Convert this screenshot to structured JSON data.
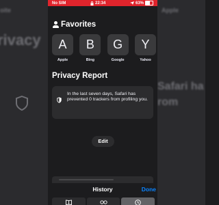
{
  "status_bar": {
    "carrier": "No SIM",
    "time": "22:34",
    "battery": "63%"
  },
  "background": {
    "left_text": "rivacy",
    "left_sub": "oite",
    "right_text": [
      "Safari ha",
      "rom"
    ],
    "right_top": "Apple"
  },
  "favorites": {
    "title": "Favorites",
    "items": [
      {
        "letter": "A",
        "label": "Apple"
      },
      {
        "letter": "B",
        "label": "Bing"
      },
      {
        "letter": "G",
        "label": "Google"
      },
      {
        "letter": "Y",
        "label": "Yahoo"
      }
    ]
  },
  "privacy_report": {
    "title": "Privacy Report",
    "text": "In the last seven days, Safari has prevented 0 trackers from profiling you."
  },
  "edit_label": "Edit",
  "sheet": {
    "title": "History",
    "done_label": "Done",
    "tab_icons": [
      "book-icon",
      "glasses-icon",
      "clock-icon"
    ],
    "active_tab": 2
  },
  "colors": {
    "status_bar": "#e0242c",
    "accent": "#0a84ff",
    "background": "#1c1c1e"
  }
}
